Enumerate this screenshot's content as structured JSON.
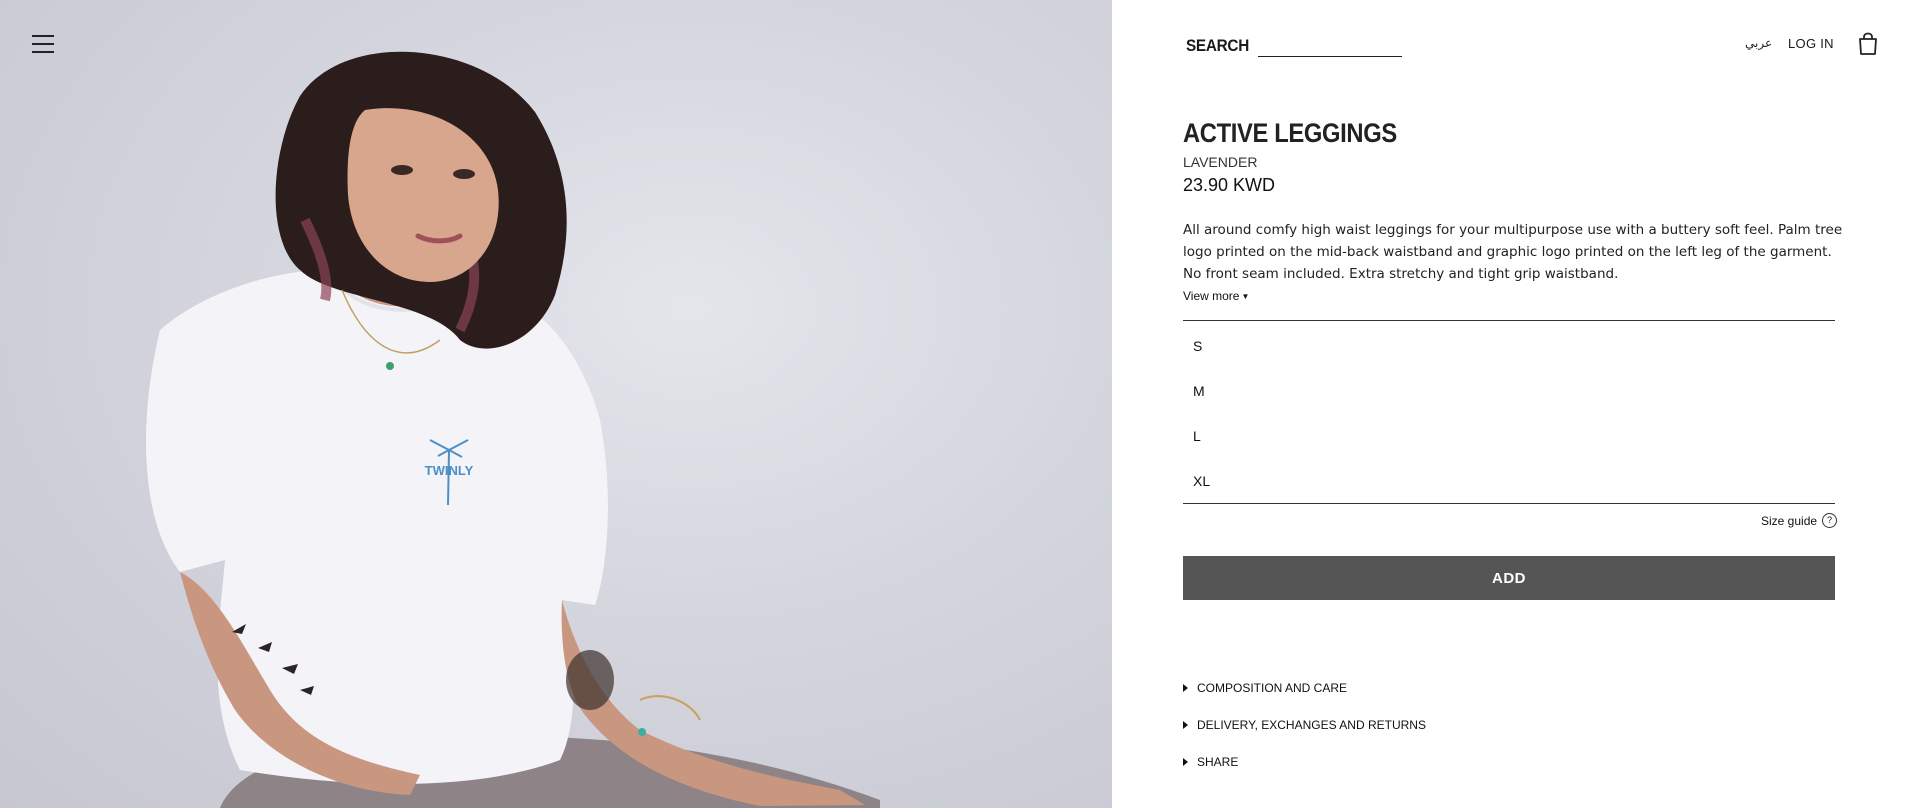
{
  "header": {
    "search_label": "SEARCH",
    "search_value": "",
    "language_link": "عربي",
    "login_label": "LOG IN"
  },
  "icons": {
    "menu": "hamburger-menu-icon",
    "bag": "shopping-bag-icon",
    "help": "question-circle-icon",
    "caret": "caret-down-icon",
    "accordion": "triangle-right-icon"
  },
  "product": {
    "title": "ACTIVE LEGGINGS",
    "color": "LAVENDER",
    "price": "23.90 KWD",
    "description": "All around comfy high waist leggings for your multipurpose use with a buttery soft feel. Palm tree logo printed on the mid-back waistband and graphic logo printed on the left leg of the garment. No front seam included. Extra stretchy and tight grip waistband.",
    "view_more": "View more",
    "photo_print_text": "TWINLY"
  },
  "sizes": [
    {
      "label": "S"
    },
    {
      "label": "M"
    },
    {
      "label": "L"
    },
    {
      "label": "XL"
    }
  ],
  "size_guide_label": "Size guide",
  "add_button_label": "ADD",
  "accordion": [
    {
      "label": "COMPOSITION AND CARE"
    },
    {
      "label": "DELIVERY, EXCHANGES AND RETURNS"
    },
    {
      "label": "SHARE"
    }
  ],
  "colors": {
    "add_button_bg": "#555555",
    "photo_background": "#d4d5dd",
    "leggings": "#8e8488",
    "shirt_logo": "#4a90c8"
  }
}
